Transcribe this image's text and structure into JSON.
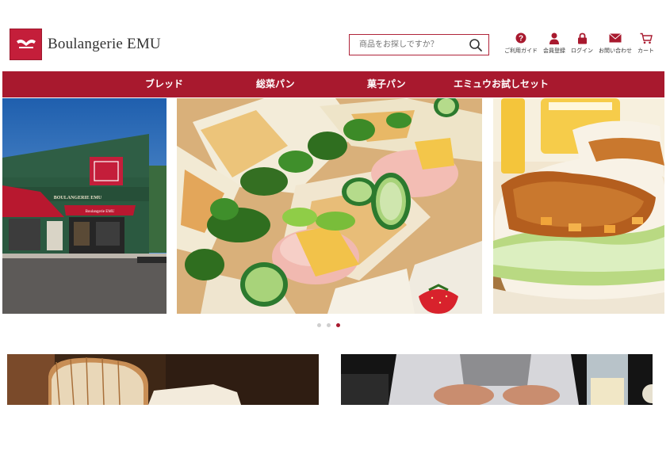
{
  "header": {
    "brand": "Boulangerie EMU",
    "search_placeholder": "商品をお探しですか？"
  },
  "util_nav": [
    {
      "label": "ご利用ガイド",
      "icon": "help-icon"
    },
    {
      "label": "会員登録",
      "icon": "user-icon"
    },
    {
      "label": "ログイン",
      "icon": "lock-icon"
    },
    {
      "label": "お問い合わせ",
      "icon": "mail-icon"
    },
    {
      "label": "カート",
      "icon": "cart-icon"
    }
  ],
  "categories": [
    {
      "label": "ブレッド"
    },
    {
      "label": "総菜パン"
    },
    {
      "label": "菓子パン"
    },
    {
      "label": "エミュウお試しセット"
    }
  ],
  "carousel": {
    "slide_count": 3,
    "active_index": 2
  },
  "storefront": {
    "sign_text": "BOULANGERIE EMU",
    "awning_text": "Boulangerie EMU"
  },
  "colors": {
    "brand_red": "#a8192e",
    "accent_red": "#c41e3a"
  }
}
